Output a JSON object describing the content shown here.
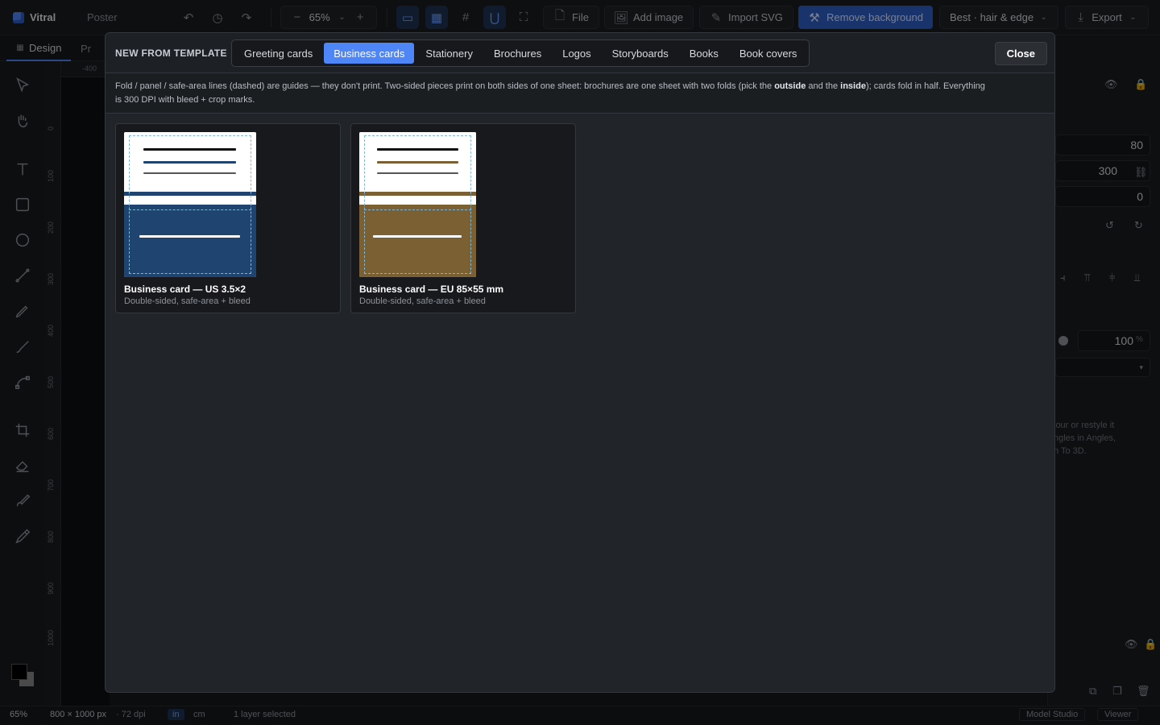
{
  "topbar": {
    "app_name": "Vitral",
    "doc_name": "Poster",
    "zoom": "65%",
    "file_label": "File",
    "add_image_label": "Add image",
    "import_svg_label": "Import SVG",
    "remove_bg_label": "Remove background",
    "bg_mode": "Best · hair & edge",
    "export_label": "Export"
  },
  "left_tabs": {
    "design": "Design",
    "other": "Pr"
  },
  "ruler": {
    "h_label": "-400",
    "v_labels": [
      "0",
      "100",
      "200",
      "300",
      "400",
      "500",
      "600",
      "700",
      "800",
      "900",
      "1000"
    ]
  },
  "right_panel": {
    "y": "80",
    "h": "300",
    "r": "0",
    "opacity": "100",
    "opacity_unit": "%",
    "hint": "lour or restyle it\nngles in Angles,\nn To 3D."
  },
  "status": {
    "zoom": "65%",
    "size": "800 × 1000 px",
    "dpi": "· 72 dpi",
    "unit_in": "in",
    "unit_cm": "cm",
    "selection": "1 layer selected",
    "model_studio": "Model Studio",
    "viewer": "Viewer"
  },
  "modal": {
    "title": "NEW FROM TEMPLATE",
    "tabs": [
      "Greeting cards",
      "Business cards",
      "Stationery",
      "Brochures",
      "Logos",
      "Storyboards",
      "Books",
      "Book covers"
    ],
    "active_tab": "Business cards",
    "close_label": "Close",
    "note_1": "Fold / panel / safe-area lines (dashed) are guides — they don't print. Two-sided pieces print on both sides of one sheet: brochures are one sheet with two folds (pick the ",
    "note_b1": "outside",
    "note_2": " and the ",
    "note_b2": "inside",
    "note_3": "); cards fold in half. Everything",
    "note_4": "is 300 DPI with bleed + crop marks.",
    "templates": [
      {
        "title": "Business card — US 3.5×2",
        "subtitle": "Double-sided, safe-area + bleed",
        "accent": "#1f4470"
      },
      {
        "title": "Business card — EU 85×55 mm",
        "subtitle": "Double-sided, safe-area + bleed",
        "accent": "#7a6032"
      }
    ]
  }
}
